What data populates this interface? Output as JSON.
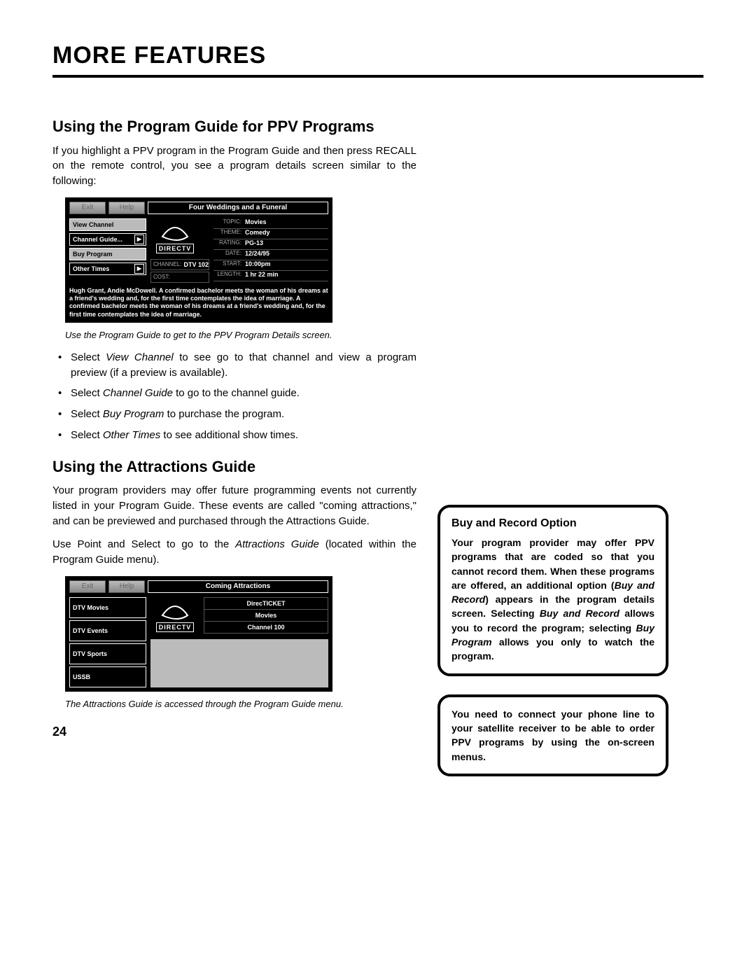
{
  "page_title": "MORE FEATURES",
  "section1": {
    "heading": "Using the Program Guide for PPV Programs",
    "intro": "If you highlight a PPV program in the Program Guide and then press RECALL on the remote control, you see a program details screen similar to the following:",
    "caption": "Use the Program Guide to get to the PPV Program Details screen.",
    "bullets": {
      "b1_pre": "Select ",
      "b1_em": "View Channel",
      "b1_post": " to see go to that channel and view a program preview (if a preview is available).",
      "b2_pre": "Select ",
      "b2_em": "Channel Guide",
      "b2_post": " to go to the channel guide.",
      "b3_pre": "Select ",
      "b3_em": "Buy Program",
      "b3_post": " to purchase the program.",
      "b4_pre": "Select ",
      "b4_em": "Other Times",
      "b4_post": " to see additional show times."
    }
  },
  "screenshot1": {
    "exit": "Exit",
    "help": "Help",
    "title": "Four Weddings and a Funeral",
    "left_buttons": [
      "View Channel",
      "Channel Guide...",
      "Buy Program",
      "Other Times"
    ],
    "logo_text": "DIRECTV",
    "meta": {
      "topic_k": "TOPIC:",
      "topic_v": "Movies",
      "theme_k": "THEME:",
      "theme_v": "Comedy",
      "rating_k": "RATING:",
      "rating_v": "PG-13",
      "date_k": "DATE:",
      "date_v": "12/24/95",
      "start_k": "START:",
      "start_v": "10:00pm",
      "length_k": "LENGTH:",
      "length_v": "1 hr 22 min",
      "channel_k": "CHANNEL:",
      "channel_v": "DTV 102",
      "cost_k": "COST:",
      "cost_v": ""
    },
    "desc": "Hugh Grant, Andie McDowell. A confirmed bachelor meets the woman of his dreams at a friend's wedding and, for the first time contemplates the idea of marriage. A confirmed bachelor meets the woman of his dreams at a friend's wedding and, for the first time contemplates the idea of marriage."
  },
  "section2": {
    "heading": "Using the Attractions Guide",
    "p1": "Your program providers may offer future programming events not currently listed in your Program Guide. These events are called \"coming attractions,\" and can be previewed and purchased through the Attractions Guide.",
    "p2_pre": "Use Point and Select to go to the ",
    "p2_em": "Attractions Guide",
    "p2_post": " (located within the Program Guide menu).",
    "caption": "The Attractions Guide is accessed through the Program Guide menu."
  },
  "screenshot2": {
    "exit": "Exit",
    "help": "Help",
    "title": "Coming Attractions",
    "left_buttons": [
      "DTV Movies",
      "DTV Events",
      "DTV Sports",
      "USSB"
    ],
    "logo_text": "DIRECTV",
    "info": [
      "DirecTICKET",
      "Movies",
      "Channel 100"
    ]
  },
  "sidebar": {
    "box1_h": "Buy and Record Option",
    "box1_t1": "Your program provider may offer PPV programs that are coded so that you cannot record them. When these programs are offered, an additional option (",
    "box1_em1": "Buy and Record",
    "box1_t2": ") appears in the program details screen. Selecting ",
    "box1_em2": "Buy and Record",
    "box1_t3": " allows you to record the program; selecting ",
    "box1_em3": "Buy Program",
    "box1_t4": " allows you only to watch the program.",
    "box2": "You need to connect your phone line to your satellite receiver to be able to order PPV programs by using the on-screen menus."
  },
  "page_number": "24"
}
